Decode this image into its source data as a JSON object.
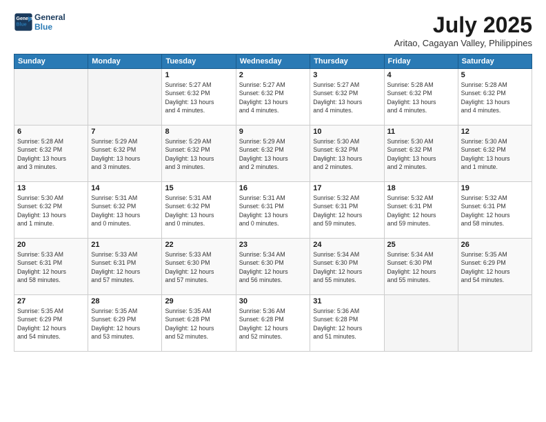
{
  "header": {
    "logo_line1": "General",
    "logo_line2": "Blue",
    "title": "July 2025",
    "subtitle": "Aritao, Cagayan Valley, Philippines"
  },
  "columns": [
    "Sunday",
    "Monday",
    "Tuesday",
    "Wednesday",
    "Thursday",
    "Friday",
    "Saturday"
  ],
  "weeks": [
    {
      "days": [
        {
          "num": "",
          "info": "",
          "empty": true
        },
        {
          "num": "",
          "info": "",
          "empty": true
        },
        {
          "num": "1",
          "info": "Sunrise: 5:27 AM\nSunset: 6:32 PM\nDaylight: 13 hours\nand 4 minutes."
        },
        {
          "num": "2",
          "info": "Sunrise: 5:27 AM\nSunset: 6:32 PM\nDaylight: 13 hours\nand 4 minutes."
        },
        {
          "num": "3",
          "info": "Sunrise: 5:27 AM\nSunset: 6:32 PM\nDaylight: 13 hours\nand 4 minutes."
        },
        {
          "num": "4",
          "info": "Sunrise: 5:28 AM\nSunset: 6:32 PM\nDaylight: 13 hours\nand 4 minutes."
        },
        {
          "num": "5",
          "info": "Sunrise: 5:28 AM\nSunset: 6:32 PM\nDaylight: 13 hours\nand 4 minutes."
        }
      ]
    },
    {
      "days": [
        {
          "num": "6",
          "info": "Sunrise: 5:28 AM\nSunset: 6:32 PM\nDaylight: 13 hours\nand 3 minutes."
        },
        {
          "num": "7",
          "info": "Sunrise: 5:29 AM\nSunset: 6:32 PM\nDaylight: 13 hours\nand 3 minutes."
        },
        {
          "num": "8",
          "info": "Sunrise: 5:29 AM\nSunset: 6:32 PM\nDaylight: 13 hours\nand 3 minutes."
        },
        {
          "num": "9",
          "info": "Sunrise: 5:29 AM\nSunset: 6:32 PM\nDaylight: 13 hours\nand 2 minutes."
        },
        {
          "num": "10",
          "info": "Sunrise: 5:30 AM\nSunset: 6:32 PM\nDaylight: 13 hours\nand 2 minutes."
        },
        {
          "num": "11",
          "info": "Sunrise: 5:30 AM\nSunset: 6:32 PM\nDaylight: 13 hours\nand 2 minutes."
        },
        {
          "num": "12",
          "info": "Sunrise: 5:30 AM\nSunset: 6:32 PM\nDaylight: 13 hours\nand 1 minute."
        }
      ]
    },
    {
      "days": [
        {
          "num": "13",
          "info": "Sunrise: 5:30 AM\nSunset: 6:32 PM\nDaylight: 13 hours\nand 1 minute."
        },
        {
          "num": "14",
          "info": "Sunrise: 5:31 AM\nSunset: 6:32 PM\nDaylight: 13 hours\nand 0 minutes."
        },
        {
          "num": "15",
          "info": "Sunrise: 5:31 AM\nSunset: 6:32 PM\nDaylight: 13 hours\nand 0 minutes."
        },
        {
          "num": "16",
          "info": "Sunrise: 5:31 AM\nSunset: 6:31 PM\nDaylight: 13 hours\nand 0 minutes."
        },
        {
          "num": "17",
          "info": "Sunrise: 5:32 AM\nSunset: 6:31 PM\nDaylight: 12 hours\nand 59 minutes."
        },
        {
          "num": "18",
          "info": "Sunrise: 5:32 AM\nSunset: 6:31 PM\nDaylight: 12 hours\nand 59 minutes."
        },
        {
          "num": "19",
          "info": "Sunrise: 5:32 AM\nSunset: 6:31 PM\nDaylight: 12 hours\nand 58 minutes."
        }
      ]
    },
    {
      "days": [
        {
          "num": "20",
          "info": "Sunrise: 5:33 AM\nSunset: 6:31 PM\nDaylight: 12 hours\nand 58 minutes."
        },
        {
          "num": "21",
          "info": "Sunrise: 5:33 AM\nSunset: 6:31 PM\nDaylight: 12 hours\nand 57 minutes."
        },
        {
          "num": "22",
          "info": "Sunrise: 5:33 AM\nSunset: 6:30 PM\nDaylight: 12 hours\nand 57 minutes."
        },
        {
          "num": "23",
          "info": "Sunrise: 5:34 AM\nSunset: 6:30 PM\nDaylight: 12 hours\nand 56 minutes."
        },
        {
          "num": "24",
          "info": "Sunrise: 5:34 AM\nSunset: 6:30 PM\nDaylight: 12 hours\nand 55 minutes."
        },
        {
          "num": "25",
          "info": "Sunrise: 5:34 AM\nSunset: 6:30 PM\nDaylight: 12 hours\nand 55 minutes."
        },
        {
          "num": "26",
          "info": "Sunrise: 5:35 AM\nSunset: 6:29 PM\nDaylight: 12 hours\nand 54 minutes."
        }
      ]
    },
    {
      "days": [
        {
          "num": "27",
          "info": "Sunrise: 5:35 AM\nSunset: 6:29 PM\nDaylight: 12 hours\nand 54 minutes."
        },
        {
          "num": "28",
          "info": "Sunrise: 5:35 AM\nSunset: 6:29 PM\nDaylight: 12 hours\nand 53 minutes."
        },
        {
          "num": "29",
          "info": "Sunrise: 5:35 AM\nSunset: 6:28 PM\nDaylight: 12 hours\nand 52 minutes."
        },
        {
          "num": "30",
          "info": "Sunrise: 5:36 AM\nSunset: 6:28 PM\nDaylight: 12 hours\nand 52 minutes."
        },
        {
          "num": "31",
          "info": "Sunrise: 5:36 AM\nSunset: 6:28 PM\nDaylight: 12 hours\nand 51 minutes."
        },
        {
          "num": "",
          "info": "",
          "empty": true
        },
        {
          "num": "",
          "info": "",
          "empty": true
        }
      ]
    }
  ]
}
